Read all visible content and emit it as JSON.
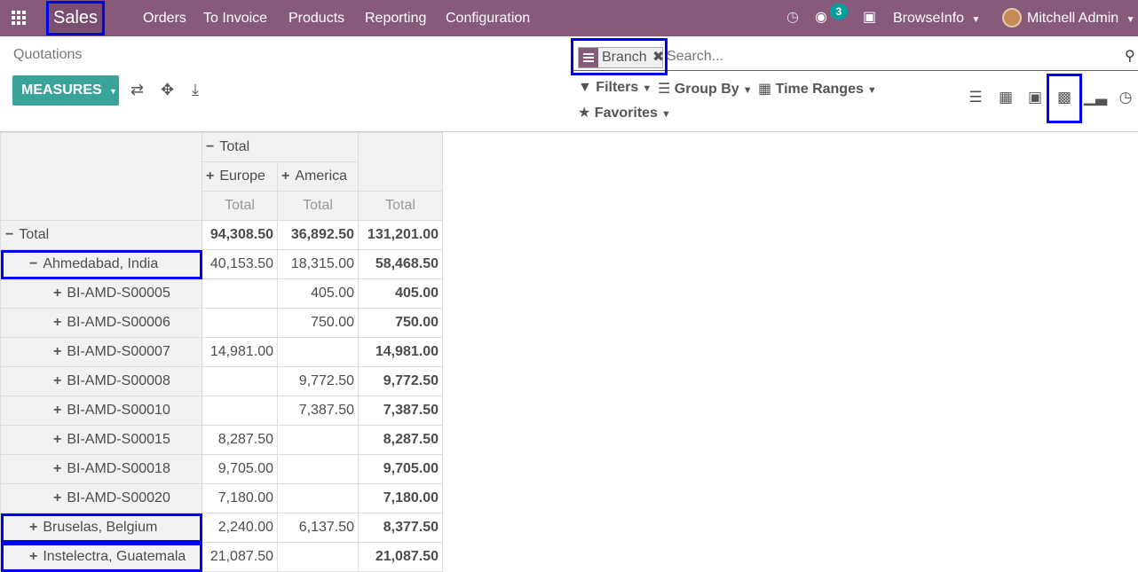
{
  "navbar": {
    "app_name": "Sales",
    "menu": [
      "Orders",
      "To Invoice",
      "Products",
      "Reporting",
      "Configuration"
    ],
    "message_count": "3",
    "company": "BrowseInfo",
    "user": "Mitchell Admin"
  },
  "control_panel": {
    "breadcrumb": "Quotations",
    "measures_label": "MEASURES",
    "facet_label": "Branch",
    "search_placeholder": "Search...",
    "filters": "Filters",
    "group_by": "Group By",
    "time_ranges": "Time Ranges",
    "favorites": "Favorites"
  },
  "pivot": {
    "col_header_total": "Total",
    "col_groups": [
      "Europe",
      "America"
    ],
    "measure_labels": [
      "Total",
      "Total",
      "Total"
    ],
    "rows": [
      {
        "label": "Total",
        "sym": "−",
        "indent": 0,
        "europe": "94,308.50",
        "america": "36,892.50",
        "total": "131,201.00",
        "bold": true
      },
      {
        "label": "Ahmedabad, India",
        "sym": "−",
        "indent": 1,
        "europe": "40,153.50",
        "america": "18,315.00",
        "total": "58,468.50"
      },
      {
        "label": "BI-AMD-S00005",
        "sym": "+",
        "indent": 2,
        "europe": "",
        "america": "405.00",
        "total": "405.00"
      },
      {
        "label": "BI-AMD-S00006",
        "sym": "+",
        "indent": 2,
        "europe": "",
        "america": "750.00",
        "total": "750.00"
      },
      {
        "label": "BI-AMD-S00007",
        "sym": "+",
        "indent": 2,
        "europe": "14,981.00",
        "america": "",
        "total": "14,981.00"
      },
      {
        "label": "BI-AMD-S00008",
        "sym": "+",
        "indent": 2,
        "europe": "",
        "america": "9,772.50",
        "total": "9,772.50"
      },
      {
        "label": "BI-AMD-S00010",
        "sym": "+",
        "indent": 2,
        "europe": "",
        "america": "7,387.50",
        "total": "7,387.50"
      },
      {
        "label": "BI-AMD-S00015",
        "sym": "+",
        "indent": 2,
        "europe": "8,287.50",
        "america": "",
        "total": "8,287.50"
      },
      {
        "label": "BI-AMD-S00018",
        "sym": "+",
        "indent": 2,
        "europe": "9,705.00",
        "america": "",
        "total": "9,705.00"
      },
      {
        "label": "BI-AMD-S00020",
        "sym": "+",
        "indent": 2,
        "europe": "7,180.00",
        "america": "",
        "total": "7,180.00"
      },
      {
        "label": "Bruselas, Belgium",
        "sym": "+",
        "indent": 1,
        "europe": "2,240.00",
        "america": "6,137.50",
        "total": "8,377.50"
      },
      {
        "label": "Instelectra, Guatemala",
        "sym": "+",
        "indent": 1,
        "europe": "21,087.50",
        "america": "",
        "total": "21,087.50"
      }
    ]
  }
}
